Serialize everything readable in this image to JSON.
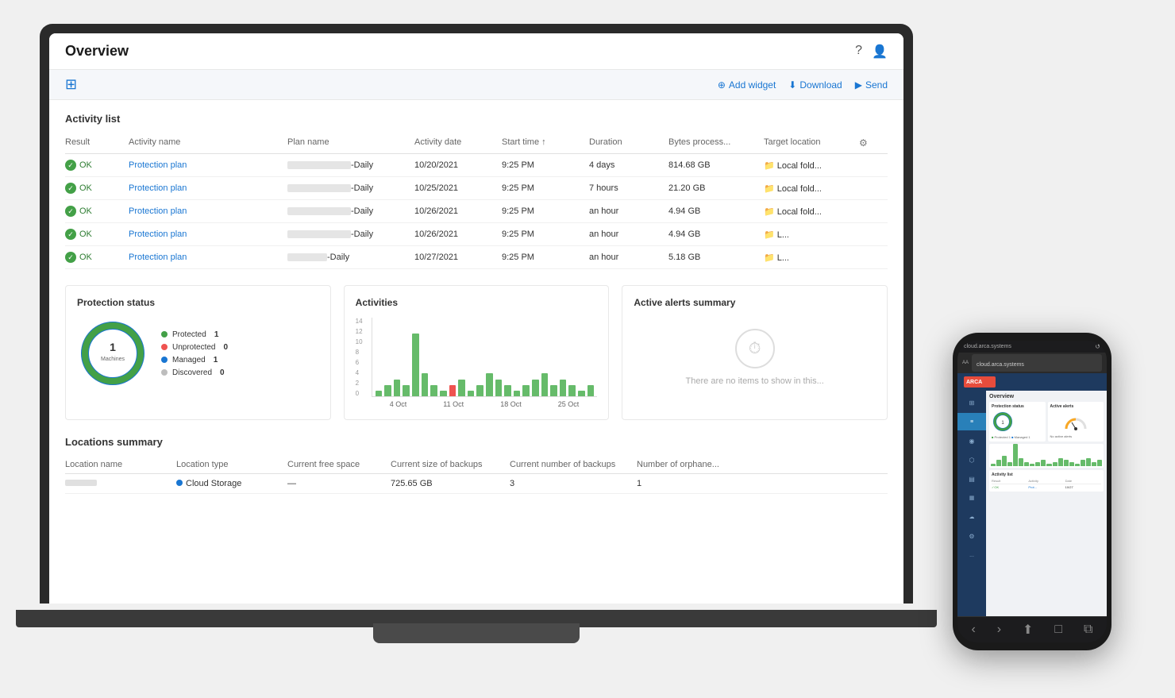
{
  "page": {
    "title": "Overview",
    "toolbar": {
      "add_widget": "Add widget",
      "download": "Download",
      "send": "Send"
    }
  },
  "activity_list": {
    "section_title": "Activity list",
    "columns": [
      "Result",
      "Activity name",
      "Plan name",
      "Activity date",
      "Start time ↑",
      "Duration",
      "Bytes process...",
      "Target location",
      ""
    ],
    "rows": [
      {
        "result": "OK",
        "activity_name": "Protection plan",
        "plan_name": "Daily",
        "activity_date": "10/20/2021",
        "start_time": "9:25 PM",
        "duration": "4 days",
        "bytes": "814.68 GB",
        "target": "Local fold..."
      },
      {
        "result": "OK",
        "activity_name": "Protection plan",
        "plan_name": "Daily",
        "activity_date": "10/25/2021",
        "start_time": "9:25 PM",
        "duration": "7 hours",
        "bytes": "21.20 GB",
        "target": "Local fold..."
      },
      {
        "result": "OK",
        "activity_name": "Protection plan",
        "plan_name": "Daily",
        "activity_date": "10/26/2021",
        "start_time": "9:25 PM",
        "duration": "an hour",
        "bytes": "4.94 GB",
        "target": "Local fold..."
      },
      {
        "result": "OK",
        "activity_name": "Protection plan",
        "plan_name": "Daily",
        "activity_date": "10/26/2021",
        "start_time": "9:25 PM",
        "duration": "an hour",
        "bytes": "4.94 GB",
        "target": "L..."
      },
      {
        "result": "OK",
        "activity_name": "Protection plan",
        "plan_name": "Daily",
        "activity_date": "10/27/2021",
        "start_time": "9:25 PM",
        "duration": "an hour",
        "bytes": "5.18 GB",
        "target": "L..."
      }
    ]
  },
  "protection_status": {
    "section_title": "Protection status",
    "donut": {
      "center_number": "1",
      "center_label": "Machines"
    },
    "legend": [
      {
        "label": "Protected",
        "value": "1",
        "color": "#43a047"
      },
      {
        "label": "Unprotected",
        "value": "0",
        "color": "#ef5350"
      },
      {
        "label": "Managed",
        "value": "1",
        "color": "#1976d2"
      },
      {
        "label": "Discovered",
        "value": "0",
        "color": "#bdbdbd"
      }
    ]
  },
  "activities": {
    "section_title": "Activities",
    "y_labels": [
      "14",
      "12",
      "10",
      "8",
      "6",
      "4",
      "2",
      "0"
    ],
    "x_labels": [
      "4 Oct",
      "11 Oct",
      "18 Oct",
      "25 Oct"
    ],
    "bars": [
      1,
      2,
      3,
      2,
      11,
      4,
      2,
      1,
      2,
      3,
      1,
      2,
      4,
      3,
      2,
      1,
      2,
      3,
      4,
      2,
      3,
      2,
      1,
      2
    ],
    "bar_colors": [
      "g",
      "g",
      "g",
      "g",
      "g",
      "g",
      "g",
      "g",
      "r",
      "g",
      "g",
      "g",
      "g",
      "g",
      "g",
      "g",
      "g",
      "g",
      "g",
      "g",
      "g",
      "g",
      "g",
      "g"
    ]
  },
  "active_alerts": {
    "section_title": "Active alerts summary",
    "empty_message": "There are no items to show in this..."
  },
  "locations_summary": {
    "section_title": "Locations summary",
    "columns": [
      "Location name",
      "Location type",
      "Current free space",
      "Current size of backups",
      "Current number of backups",
      "Number of orphane..."
    ],
    "rows": [
      {
        "name": "—",
        "type": "Cloud Storage",
        "free_space": "—",
        "size": "725.65 GB",
        "count": "3",
        "orphaned": "1"
      }
    ]
  },
  "phone": {
    "url": "cloud.arca.systems",
    "sidebar_items": [
      "☰",
      "⊞",
      "★",
      "⬡",
      "▤",
      "⊕",
      "↑",
      "☁",
      "⚙",
      "..."
    ],
    "overview_label": "Overview"
  }
}
